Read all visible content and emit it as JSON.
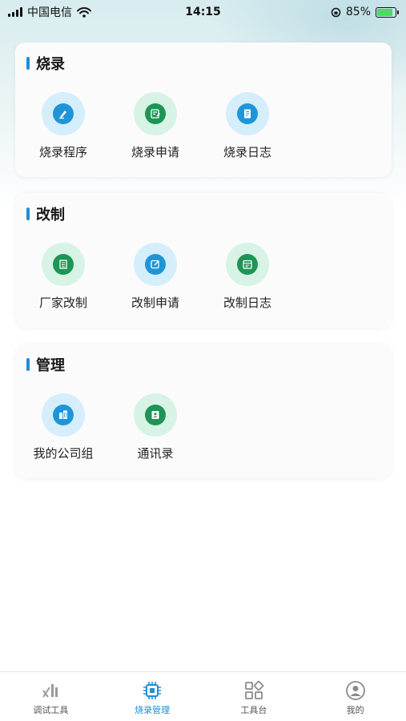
{
  "status_bar": {
    "carrier": "中国电信",
    "time": "14:15",
    "battery": "85%",
    "battery_level": 0.85
  },
  "sections": [
    {
      "title": "烧录",
      "items": [
        {
          "label": "烧录程序",
          "icon": "pen-sign-icon",
          "color": "blue"
        },
        {
          "label": "烧录申请",
          "icon": "edit-document-icon",
          "color": "green"
        },
        {
          "label": "烧录日志",
          "icon": "log-document-icon",
          "color": "blue"
        }
      ]
    },
    {
      "title": "改制",
      "items": [
        {
          "label": "厂家改制",
          "icon": "building-icon",
          "color": "green"
        },
        {
          "label": "改制申请",
          "icon": "edit-square-icon",
          "color": "blue"
        },
        {
          "label": "改制日志",
          "icon": "calendar-log-icon",
          "color": "green"
        }
      ]
    },
    {
      "title": "管理",
      "items": [
        {
          "label": "我的公司组",
          "icon": "company-group-icon",
          "color": "blue"
        },
        {
          "label": "通讯录",
          "icon": "contacts-book-icon",
          "color": "green"
        }
      ]
    }
  ],
  "tabs": [
    {
      "label": "调试工具",
      "icon": "debug-tools-icon",
      "active": false
    },
    {
      "label": "烧录管理",
      "icon": "chip-icon",
      "active": true
    },
    {
      "label": "工具台",
      "icon": "grid-apps-icon",
      "active": false
    },
    {
      "label": "我的",
      "icon": "user-profile-icon",
      "active": false
    }
  ],
  "colors": {
    "accent": "#1f8fd6",
    "icon_blue": "#1f95d8",
    "icon_green": "#1e9455"
  }
}
